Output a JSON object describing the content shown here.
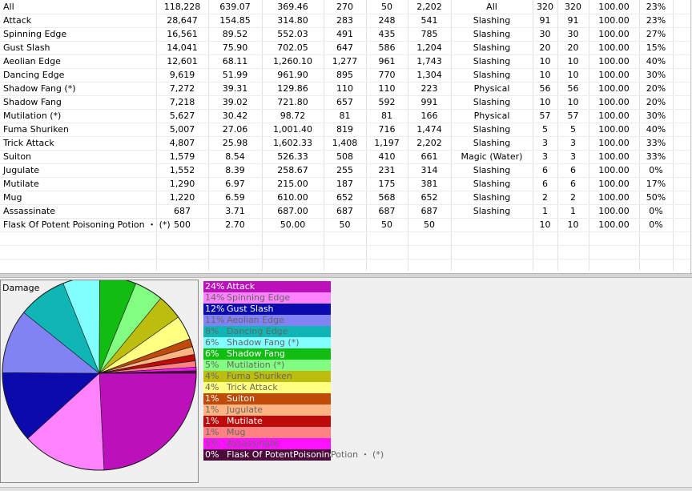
{
  "table": {
    "rows": [
      [
        "All",
        "118,228",
        "639.07",
        "369.46",
        "270",
        "50",
        "2,202",
        "All",
        "320",
        "320",
        "100.00",
        "23%"
      ],
      [
        "Attack",
        "28,647",
        "154.85",
        "314.80",
        "283",
        "248",
        "541",
        "Slashing",
        "91",
        "91",
        "100.00",
        "23%"
      ],
      [
        "Spinning Edge",
        "16,561",
        "89.52",
        "552.03",
        "491",
        "435",
        "785",
        "Slashing",
        "30",
        "30",
        "100.00",
        "27%"
      ],
      [
        "Gust Slash",
        "14,041",
        "75.90",
        "702.05",
        "647",
        "586",
        "1,204",
        "Slashing",
        "20",
        "20",
        "100.00",
        "15%"
      ],
      [
        "Aeolian Edge",
        "12,601",
        "68.11",
        "1,260.10",
        "1,277",
        "961",
        "1,743",
        "Slashing",
        "10",
        "10",
        "100.00",
        "40%"
      ],
      [
        "Dancing Edge",
        "9,619",
        "51.99",
        "961.90",
        "895",
        "770",
        "1,304",
        "Slashing",
        "10",
        "10",
        "100.00",
        "30%"
      ],
      [
        "Shadow Fang (*)",
        "7,272",
        "39.31",
        "129.86",
        "110",
        "110",
        "223",
        "Physical",
        "56",
        "56",
        "100.00",
        "20%"
      ],
      [
        "Shadow Fang",
        "7,218",
        "39.02",
        "721.80",
        "657",
        "592",
        "991",
        "Slashing",
        "10",
        "10",
        "100.00",
        "20%"
      ],
      [
        "Mutilation (*)",
        "5,627",
        "30.42",
        "98.72",
        "81",
        "81",
        "166",
        "Physical",
        "57",
        "57",
        "100.00",
        "30%"
      ],
      [
        "Fuma Shuriken",
        "5,007",
        "27.06",
        "1,001.40",
        "819",
        "716",
        "1,474",
        "Slashing",
        "5",
        "5",
        "100.00",
        "40%"
      ],
      [
        "Trick Attack",
        "4,807",
        "25.98",
        "1,602.33",
        "1,408",
        "1,197",
        "2,202",
        "Slashing",
        "3",
        "3",
        "100.00",
        "33%"
      ],
      [
        "Suiton",
        "1,579",
        "8.54",
        "526.33",
        "508",
        "410",
        "661",
        "Magic (Water)",
        "3",
        "3",
        "100.00",
        "33%"
      ],
      [
        "Jugulate",
        "1,552",
        "8.39",
        "258.67",
        "255",
        "231",
        "314",
        "Slashing",
        "6",
        "6",
        "100.00",
        "0%"
      ],
      [
        "Mutilate",
        "1,290",
        "6.97",
        "215.00",
        "187",
        "175",
        "381",
        "Slashing",
        "6",
        "6",
        "100.00",
        "17%"
      ],
      [
        "Mug",
        "1,220",
        "6.59",
        "610.00",
        "652",
        "568",
        "652",
        "Slashing",
        "2",
        "2",
        "100.00",
        "50%"
      ],
      [
        "Assassinate",
        "687",
        "3.71",
        "687.00",
        "687",
        "687",
        "687",
        "Slashing",
        "1",
        "1",
        "100.00",
        "0%"
      ],
      [
        "Flask Of Potent Poisoning Potion ・ (*)",
        "500",
        "2.70",
        "50.00",
        "50",
        "50",
        "50",
        "",
        "10",
        "10",
        "100.00",
        "0%"
      ]
    ]
  },
  "chart_data": {
    "type": "pie",
    "title": "Damage",
    "slices": [
      {
        "label": "Attack",
        "value": 28647,
        "pct": "24%",
        "color": "#bd10bd"
      },
      {
        "label": "Spinning Edge",
        "value": 16561,
        "pct": "14%",
        "color": "#ff82ff"
      },
      {
        "label": "Gust Slash",
        "value": 14041,
        "pct": "12%",
        "color": "#0a0aad"
      },
      {
        "label": "Aeolian Edge",
        "value": 12601,
        "pct": "11%",
        "color": "#8282f5"
      },
      {
        "label": "Dancing Edge",
        "value": 9619,
        "pct": "8%",
        "color": "#10b5b5"
      },
      {
        "label": "Shadow Fang (*)",
        "value": 7272,
        "pct": "6%",
        "color": "#82ffff"
      },
      {
        "label": "Shadow Fang",
        "value": 7218,
        "pct": "6%",
        "color": "#10bd10"
      },
      {
        "label": "Mutilation (*)",
        "value": 5627,
        "pct": "5%",
        "color": "#82ff82"
      },
      {
        "label": "Fuma Shuriken",
        "value": 5007,
        "pct": "4%",
        "color": "#bdbd10"
      },
      {
        "label": "Trick Attack",
        "value": 4807,
        "pct": "4%",
        "color": "#ffff82"
      },
      {
        "label": "Suiton",
        "value": 1579,
        "pct": "1%",
        "color": "#c04a08"
      },
      {
        "label": "Jugulate",
        "value": 1552,
        "pct": "1%",
        "color": "#ffb482"
      },
      {
        "label": "Mutilate",
        "value": 1290,
        "pct": "1%",
        "color": "#bd0a0a"
      },
      {
        "label": "Mug",
        "value": 1220,
        "pct": "1%",
        "color": "#ff8282"
      },
      {
        "label": "Assassinate",
        "value": 687,
        "pct": "1%",
        "color": "#ff10ff"
      },
      {
        "label": "Flask Of Potent Poisoning Potion ・ (*)",
        "value": 500,
        "pct": "0%",
        "color": "#4a0a3a",
        "legend_text": "Flask Of PotentPoisoning",
        "legend_overflow": "Potion ・ (*)"
      }
    ]
  }
}
